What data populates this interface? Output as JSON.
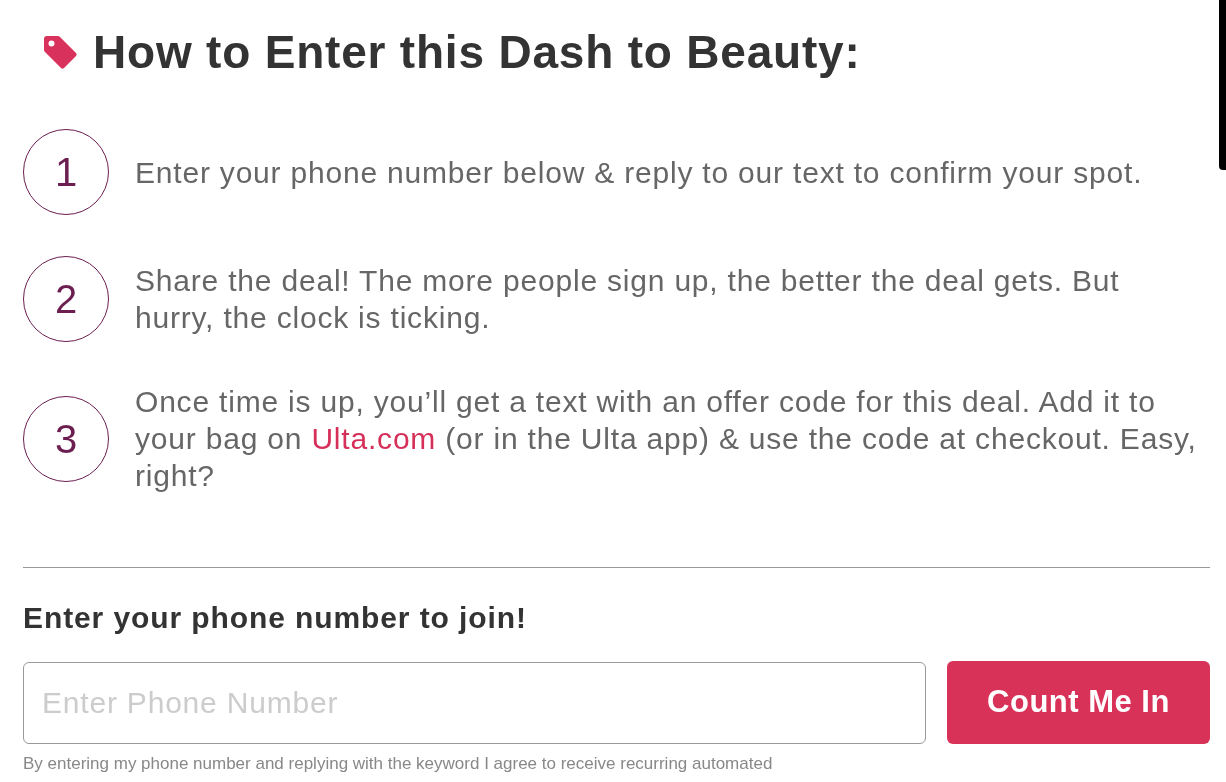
{
  "heading": "How to Enter this Dash to Beauty:",
  "steps": [
    {
      "number": "1",
      "segments": [
        {
          "kind": "text",
          "text": "Enter your phone number below & reply to our text to confirm your spot."
        }
      ]
    },
    {
      "number": "2",
      "segments": [
        {
          "kind": "text",
          "text": "Share the deal! The more people sign up, the better the deal gets. But hurry, the clock is ticking."
        }
      ]
    },
    {
      "number": "3",
      "segments": [
        {
          "kind": "text",
          "text": "Once time is up, you’ll get a text with an offer code for this deal. Add it to your bag on "
        },
        {
          "kind": "link",
          "text": "Ulta.com"
        },
        {
          "kind": "text",
          "text": " (or in the Ulta app) & use the code at checkout. Easy, right?"
        }
      ]
    }
  ],
  "signup": {
    "label": "Enter your phone number to join!",
    "phone_field": {
      "placeholder": "Enter Phone Number"
    },
    "button": "Count Me In",
    "disclaimer": "By entering my phone number and replying with the keyword I agree to receive recurring automated"
  }
}
